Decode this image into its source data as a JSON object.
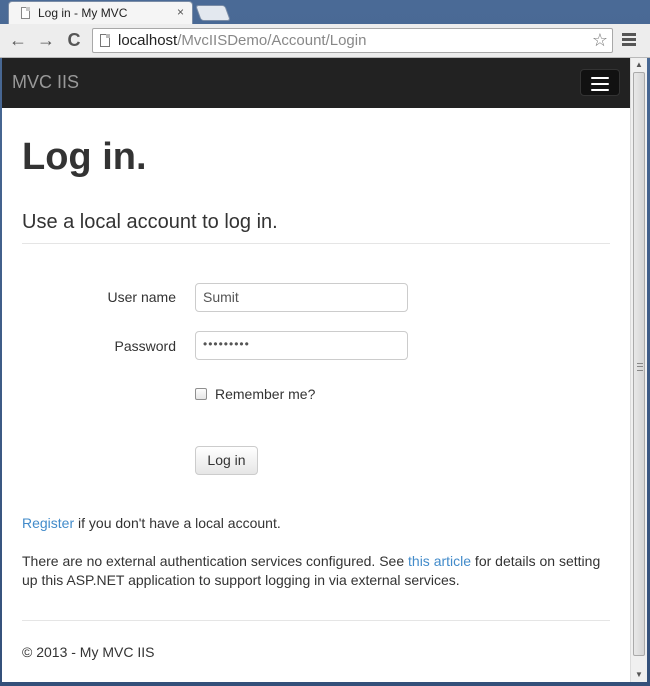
{
  "browser": {
    "tab_title": "Log in - My MVC",
    "tab_close": "×",
    "url_host": "localhost",
    "url_path": "/MvcIISDemo/Account/Login"
  },
  "navbar": {
    "brand": "MVC IIS"
  },
  "page": {
    "title": "Log in.",
    "subtitle": "Use a local account to log in."
  },
  "form": {
    "username_label": "User name",
    "username_value": "Sumit",
    "password_label": "Password",
    "password_value": "•••••••••",
    "remember_label": "Remember me?",
    "remember_checked": false,
    "submit_label": "Log in"
  },
  "register": {
    "link_text": "Register",
    "rest_text": " if you don't have a local account."
  },
  "external": {
    "text_before": "There are no external authentication services configured. See ",
    "link_text": "this article",
    "text_after": " for details on setting up this ASP.NET application to support logging in via external services."
  },
  "footer": {
    "text": "© 2013 - My MVC IIS"
  },
  "icons": {
    "back": "←",
    "forward": "→",
    "reload": "C",
    "star": "☆"
  }
}
